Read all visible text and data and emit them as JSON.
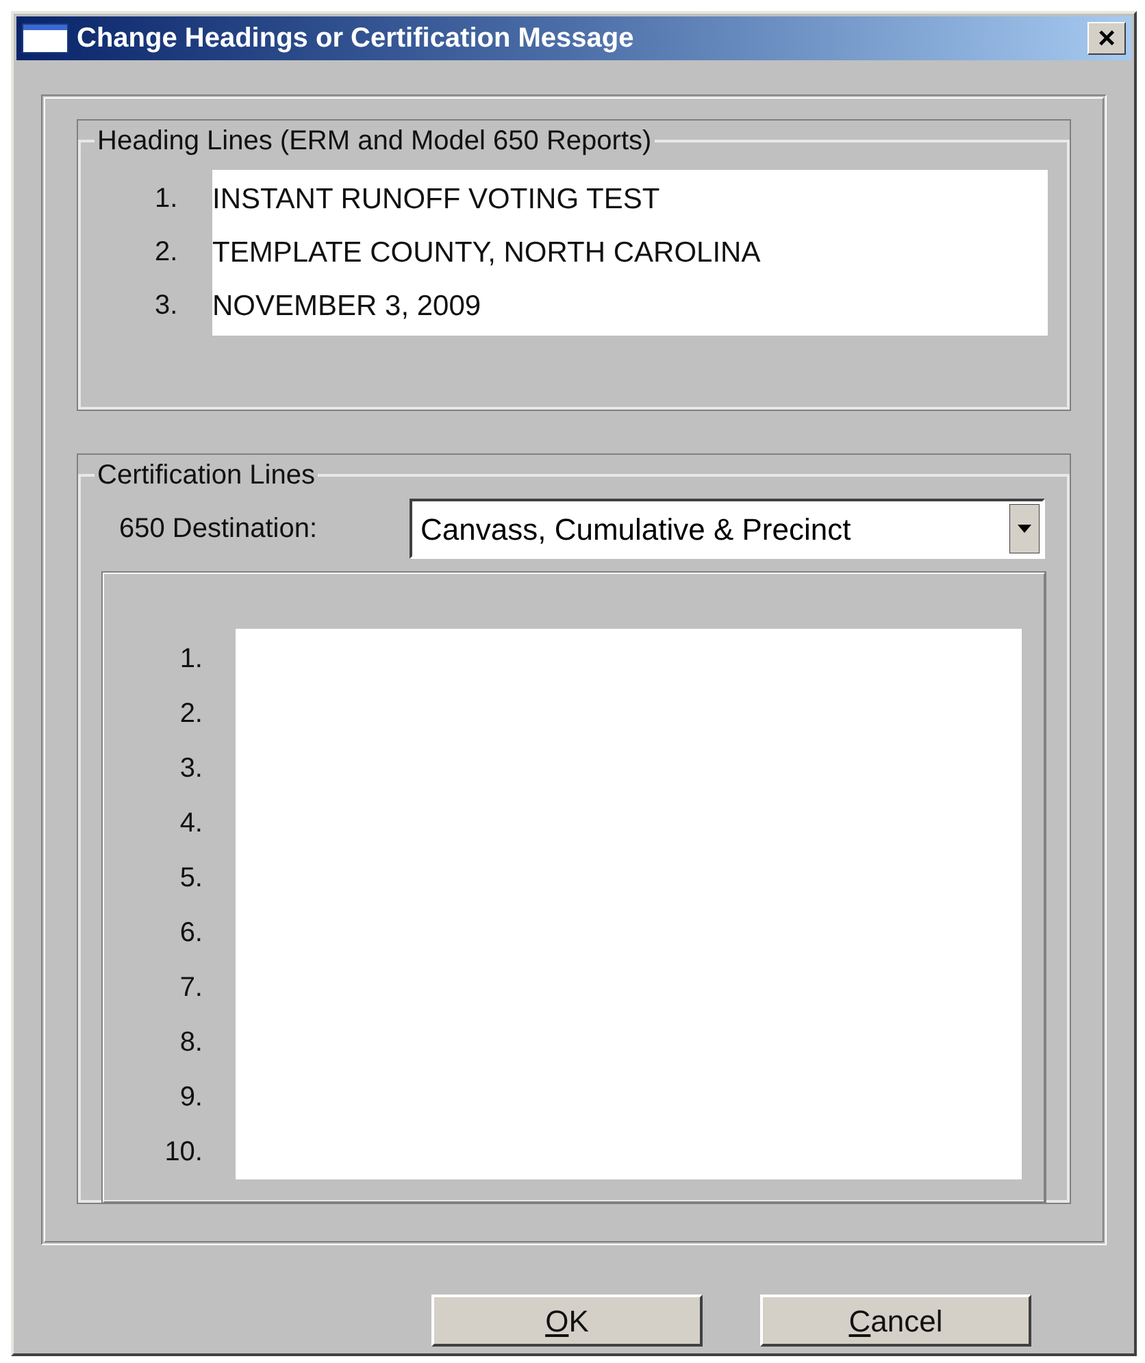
{
  "window": {
    "title": "Change Headings or Certification Message",
    "close": "×"
  },
  "heading_group": {
    "label": "Heading Lines (ERM and Model 650 Reports)",
    "lines": [
      {
        "number": "1.",
        "value": "INSTANT RUNOFF VOTING TEST"
      },
      {
        "number": "2.",
        "value": "TEMPLATE COUNTY, NORTH CAROLINA"
      },
      {
        "number": "3.",
        "value": "NOVEMBER 3, 2009"
      }
    ]
  },
  "certification_group": {
    "label": "Certification Lines",
    "destination_label": "650 Destination:",
    "destination_value": "Canvass, Cumulative & Precinct",
    "line_numbers": [
      "1.",
      "2.",
      "3.",
      "4.",
      "5.",
      "6.",
      "7.",
      "8.",
      "9.",
      "10."
    ]
  },
  "buttons": [
    {
      "mnemonic": "O",
      "rest": "K"
    },
    {
      "mnemonic": "C",
      "rest": "ancel"
    }
  ]
}
